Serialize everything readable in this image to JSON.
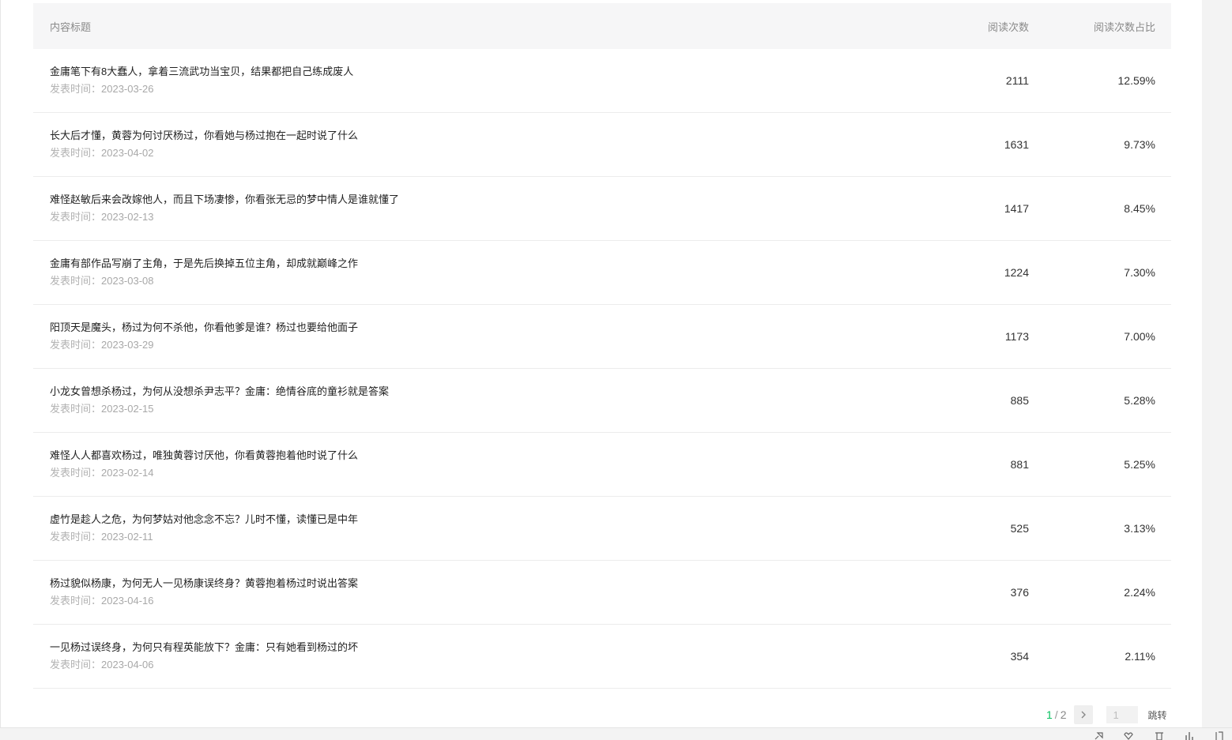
{
  "table": {
    "headers": {
      "title": "内容标题",
      "reads": "阅读次数",
      "ratio": "阅读次数占比"
    },
    "date_label": "发表时间：",
    "rows": [
      {
        "title": "金庸笔下有8大蠢人，拿着三流武功当宝贝，结果都把自己练成废人",
        "date": "2023-03-26",
        "reads": "2111",
        "ratio": "12.59%"
      },
      {
        "title": "长大后才懂，黄蓉为何讨厌杨过，你看她与杨过抱在一起时说了什么",
        "date": "2023-04-02",
        "reads": "1631",
        "ratio": "9.73%"
      },
      {
        "title": "难怪赵敏后来会改嫁他人，而且下场凄惨，你看张无忌的梦中情人是谁就懂了",
        "date": "2023-02-13",
        "reads": "1417",
        "ratio": "8.45%"
      },
      {
        "title": "金庸有部作品写崩了主角，于是先后换掉五位主角，却成就巅峰之作",
        "date": "2023-03-08",
        "reads": "1224",
        "ratio": "7.30%"
      },
      {
        "title": "阳顶天是魔头，杨过为何不杀他，你看他爹是谁？杨过也要给他面子",
        "date": "2023-03-29",
        "reads": "1173",
        "ratio": "7.00%"
      },
      {
        "title": "小龙女曾想杀杨过，为何从没想杀尹志平？金庸：绝情谷底的童衫就是答案",
        "date": "2023-02-15",
        "reads": "885",
        "ratio": "5.28%"
      },
      {
        "title": "难怪人人都喜欢杨过，唯独黄蓉讨厌他，你看黄蓉抱着他时说了什么",
        "date": "2023-02-14",
        "reads": "881",
        "ratio": "5.25%"
      },
      {
        "title": "虚竹是趁人之危，为何梦姑对他念念不忘？儿时不懂，读懂已是中年",
        "date": "2023-02-11",
        "reads": "525",
        "ratio": "3.13%"
      },
      {
        "title": "杨过貌似杨康，为何无人一见杨康误终身？黄蓉抱着杨过时说出答案",
        "date": "2023-04-16",
        "reads": "376",
        "ratio": "2.24%"
      },
      {
        "title": "一见杨过误终身，为何只有程英能放下？金庸：只有她看到杨过的坏",
        "date": "2023-04-06",
        "reads": "354",
        "ratio": "2.11%"
      }
    ]
  },
  "pagination": {
    "current": "1",
    "separator": "/",
    "total": "2",
    "next_icon": "chevron-right-icon",
    "input_value": "1",
    "jump_label": "跳转"
  },
  "colors": {
    "accent": "#07c160",
    "header_bg": "#f6f6f7",
    "muted_text": "#a8a8a8"
  }
}
